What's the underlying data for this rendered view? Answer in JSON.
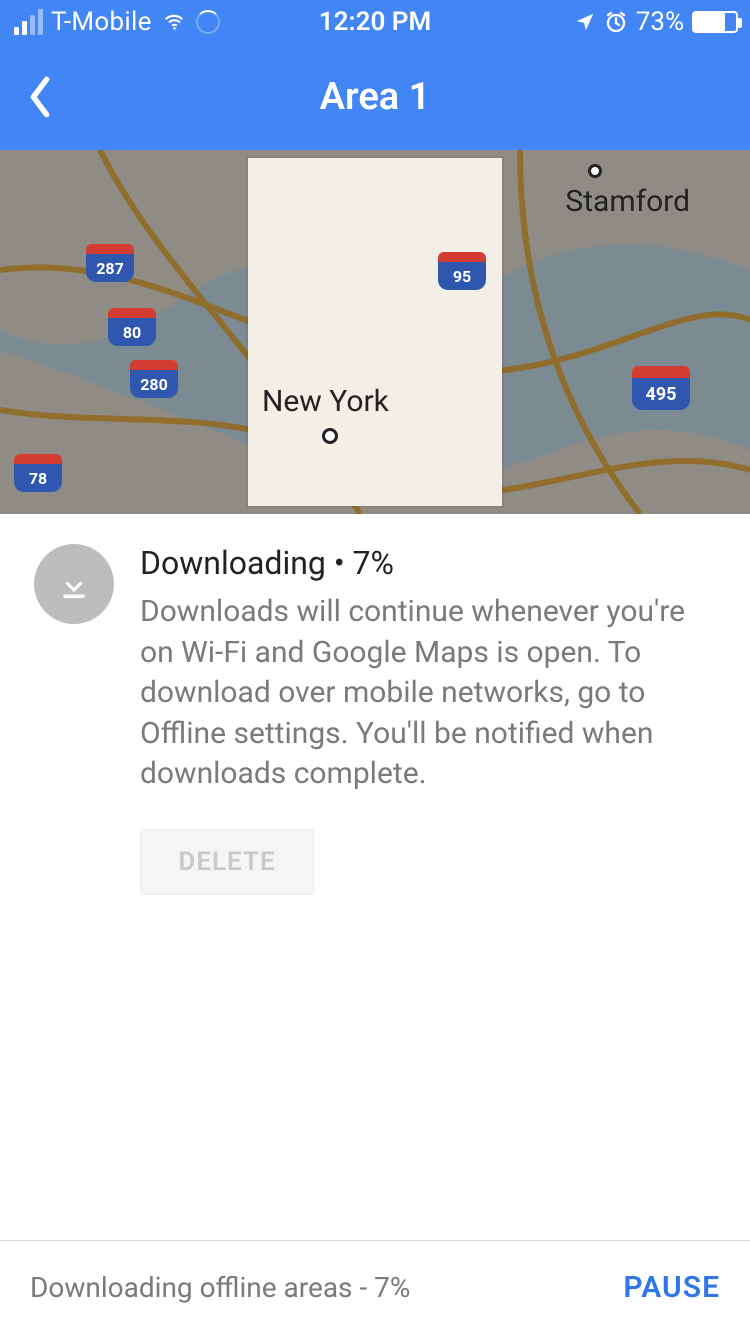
{
  "status_bar": {
    "carrier": "T-Mobile",
    "time": "12:20 PM",
    "battery_pct": "73%",
    "battery_fill_pct": 73
  },
  "header": {
    "title": "Area 1"
  },
  "map": {
    "city_label": "New York",
    "city_label_right": "Stamford",
    "shields": {
      "r287": "287",
      "r80": "80",
      "r280": "280",
      "r78": "78",
      "r95": "95",
      "r495": "495"
    }
  },
  "download": {
    "status": "Downloading • 7%",
    "description": "Downloads will continue whenever you're on Wi-Fi and Google Maps is open. To download over mobile networks, go to Offline settings. You'll be notified when downloads complete.",
    "delete_label": "DELETE"
  },
  "bottom": {
    "text": "Downloading offline areas - 7%",
    "pause_label": "PAUSE"
  }
}
